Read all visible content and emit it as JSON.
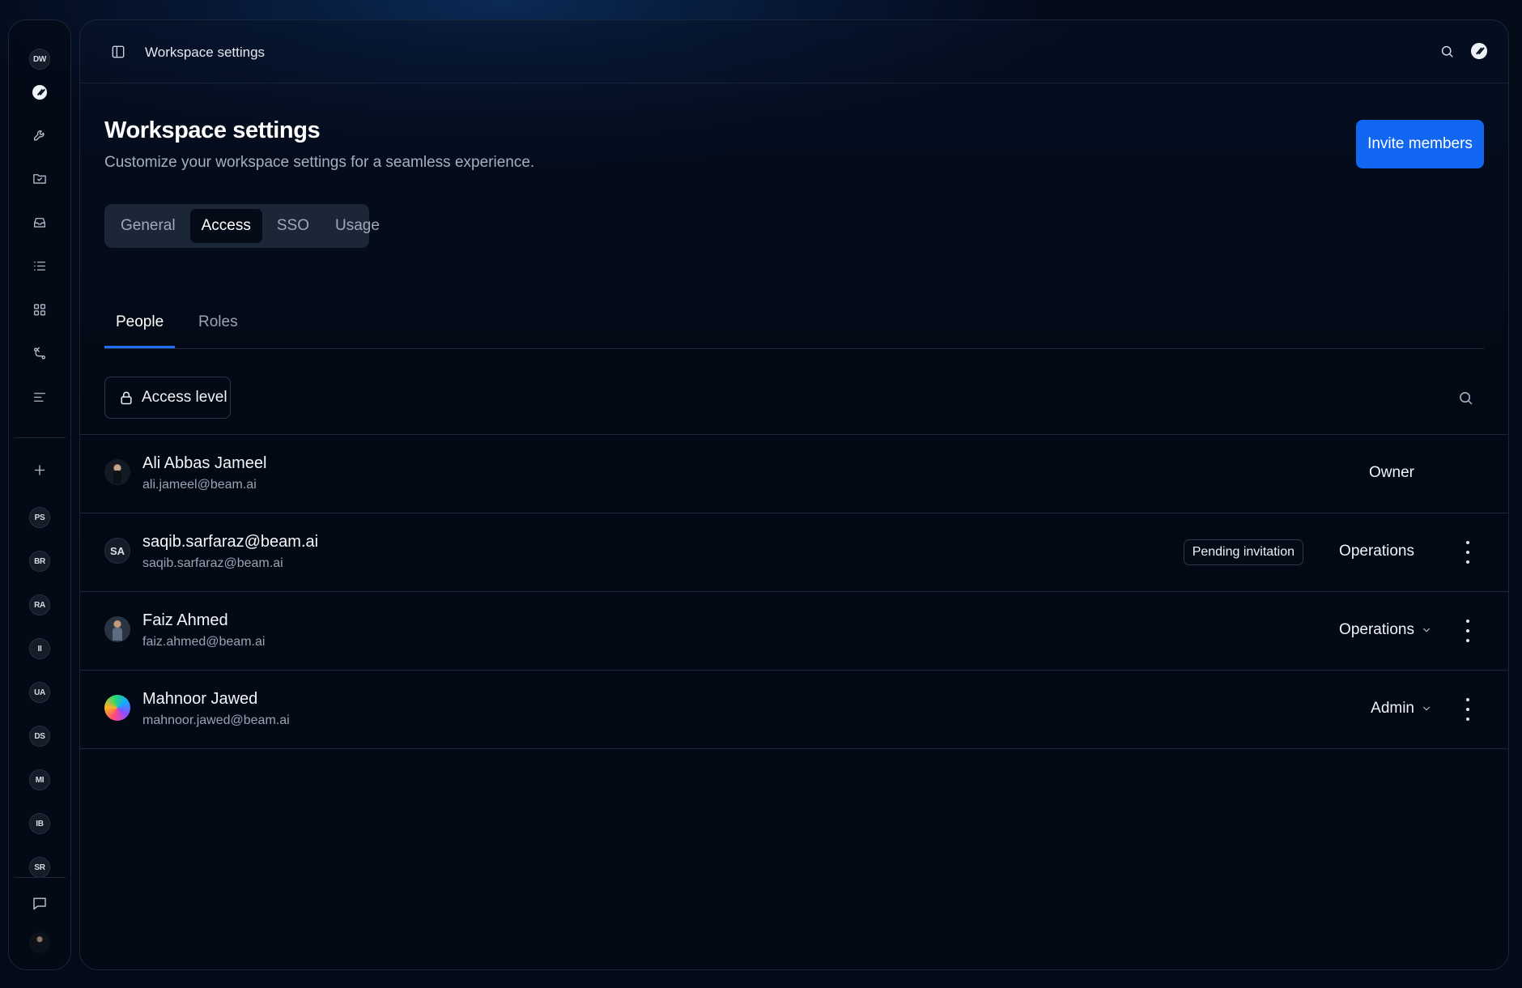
{
  "rail": {
    "workspace_initials": "DW",
    "icons": [
      "brand-logo",
      "wrench-icon",
      "folder-icon",
      "inbox-icon",
      "list-icon",
      "grid-icon",
      "git-branch-icon",
      "menu-lines-icon"
    ],
    "add_icon": "plus-icon",
    "workspaces": [
      "PS",
      "BR",
      "RA",
      "II",
      "UA",
      "DS",
      "MI",
      "IB",
      "SR"
    ],
    "bottom_icons": [
      "message-icon",
      "user-avatar"
    ]
  },
  "topbar": {
    "breadcrumb": "Workspace settings"
  },
  "header": {
    "title": "Workspace settings",
    "subtitle": "Customize your workspace settings for a seamless experience.",
    "invite_label": "Invite members"
  },
  "tabs": [
    {
      "label": "General",
      "active": false
    },
    {
      "label": "Access",
      "active": true
    },
    {
      "label": "SSO",
      "active": false
    },
    {
      "label": "Usage",
      "active": false
    }
  ],
  "subtabs": [
    {
      "label": "People",
      "active": true
    },
    {
      "label": "Roles",
      "active": false
    }
  ],
  "filters": {
    "access_level_label": "Access level"
  },
  "members": [
    {
      "name": "Ali Abbas Jameel",
      "email": "ali.jameel@beam.ai",
      "role": "Owner",
      "avatar": "photo",
      "badge": "",
      "role_dropdown": false,
      "has_menu": false
    },
    {
      "name": "saqib.sarfaraz@beam.ai",
      "email": "saqib.sarfaraz@beam.ai",
      "role": "Operations",
      "avatar": "initials",
      "initials": "SA",
      "badge": "Pending invitation",
      "role_dropdown": false,
      "has_menu": true
    },
    {
      "name": "Faiz Ahmed",
      "email": "faiz.ahmed@beam.ai",
      "role": "Operations",
      "avatar": "photo",
      "badge": "",
      "role_dropdown": true,
      "has_menu": true
    },
    {
      "name": "Mahnoor Jawed",
      "email": "mahnoor.jawed@beam.ai",
      "role": "Admin",
      "avatar": "gradient",
      "badge": "",
      "role_dropdown": true,
      "has_menu": true
    }
  ],
  "colors": {
    "accent": "#1267f2",
    "background": "#030a18"
  }
}
